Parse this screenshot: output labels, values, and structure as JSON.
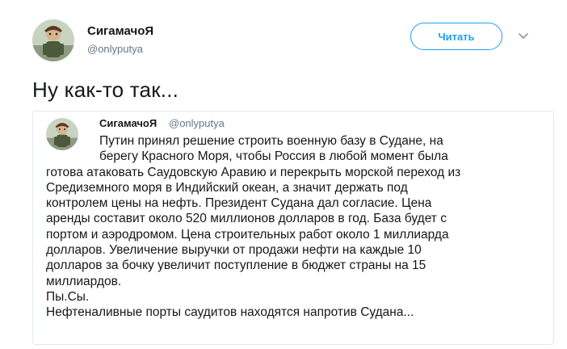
{
  "author": {
    "name": "СигамачоЯ",
    "handle": "@onlyputya"
  },
  "follow_button": {
    "label": "Читать"
  },
  "icons": {
    "caret": "chevron-down-icon",
    "avatar": "profile-avatar"
  },
  "tweet": {
    "text": "Ну как-то так..."
  },
  "quoted": {
    "name": "СигамачоЯ",
    "handle": "@onlyputya",
    "lines": [
      "Путин принял решение строить военную базу в Судане, на",
      "берегу Красного Моря, чтобы Россия в любой момент была",
      "готова атаковать Саудовскую Аравию и перекрыть морской переход из",
      "Средиземного моря в Индийский океан, а значит держать под",
      "контролем цены на нефть. Президент Судана дал согласие. Цена",
      "аренды составит около 520 миллионов долларов в год. База будет с",
      "портом и аэродромом. Цена строительных работ около 1 миллиарда",
      "долларов. Увеличение выручки от продажи нефти на каждые 10",
      "долларов за бочку увеличит поступление в бюджет страны на 15",
      "миллиардов.",
      "Пы.Сы.",
      "Нефтеналивные порты саудитов находятся напротив Судана..."
    ]
  },
  "colors": {
    "accent": "#1da1f2",
    "text": "#14171a",
    "muted": "#657786",
    "border": "#e1e8ed"
  }
}
